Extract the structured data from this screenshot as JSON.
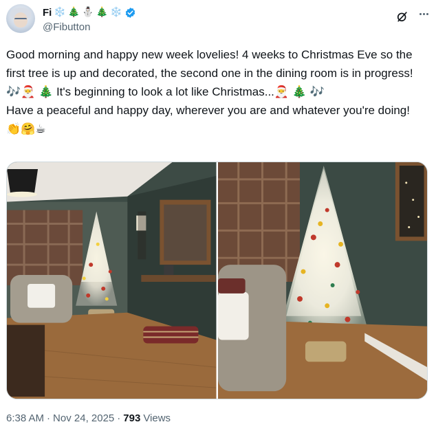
{
  "author": {
    "display_name": "Fi",
    "name_emojis": [
      "❄️",
      "🎄",
      "⛄",
      "🎄",
      "❄️"
    ],
    "handle": "@Fibutton",
    "verified_color": "#1d9bf0"
  },
  "icons": {
    "avatar": "avatar",
    "verified": "verified-badge-icon",
    "grok": "grok-icon",
    "more": "more-options-icon"
  },
  "tweet": {
    "text_line1": "Good morning and happy new week lovelies! 4 weeks to Christmas Eve so the first tree is up and decorated, the second one in the dining room is in progress! 🎶🎅 🎄 It's beginning to look a lot like Christmas...🎅 🎄 🎶",
    "text_line2": "Have a peaceful and happy day, wherever you are and whatever you're doing! 👏🤗☕"
  },
  "media": {
    "photos": [
      "living-room-christmas-tree",
      "christmas-tree-closeup"
    ]
  },
  "meta": {
    "time": "6:38 AM",
    "separator": "·",
    "date": "Nov 24, 2025",
    "views_count": "793",
    "views_label": "Views"
  }
}
